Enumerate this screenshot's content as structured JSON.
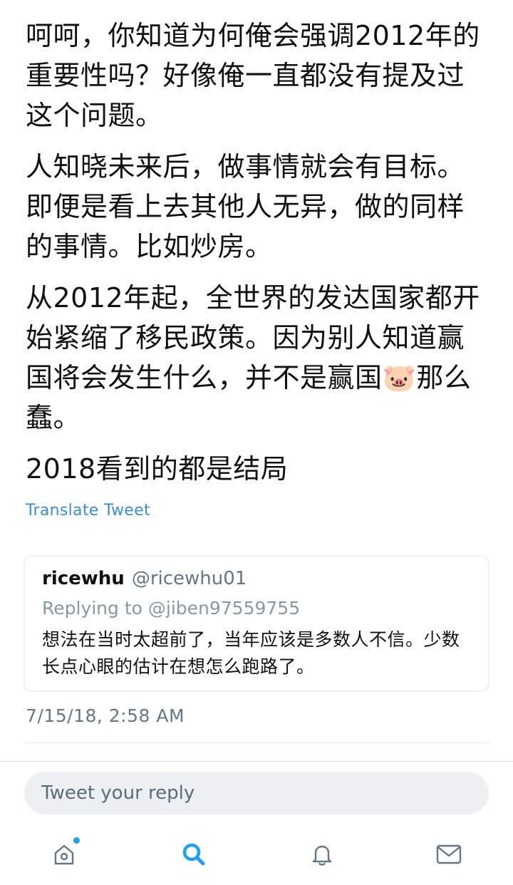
{
  "tweet": {
    "paragraphs": [
      "呵呵，你知道为何俺会强调2012年的重要性吗？好像俺一直都没有提及过这个问题。",
      "人知晓未来后，做事情就会有目标。即便是看上去其他人无异，做的同样的事情。比如炒房。",
      "从2012年起，全世界的发达国家都开始紧缩了移民政策。因为别人知道赢国将会发生什么，并不是赢国🐷那么蠢。",
      "2018看到的都是结局"
    ],
    "translate_label": "Translate Tweet",
    "timestamp": "7/15/18, 2:58 AM"
  },
  "quote": {
    "name": "ricewhu",
    "handle": "@ricewhu01",
    "replying_to": "Replying to @jiben97559755",
    "text": "想法在当时太超前了，当年应该是多数人不信。少数长点心眼的估计在想怎么跑路了。"
  },
  "reply": {
    "placeholder": "Tweet your reply"
  },
  "tabbar": {
    "items": [
      {
        "icon": "home-icon",
        "active": false,
        "notification": true
      },
      {
        "icon": "search-icon",
        "active": true,
        "notification": false
      },
      {
        "icon": "bell-icon",
        "active": false,
        "notification": false
      },
      {
        "icon": "mail-icon",
        "active": false,
        "notification": false
      }
    ]
  },
  "colors": {
    "accent": "#1da1f2",
    "link": "#3a8fd0",
    "secondary_text": "#657786",
    "icon": "#657786"
  }
}
